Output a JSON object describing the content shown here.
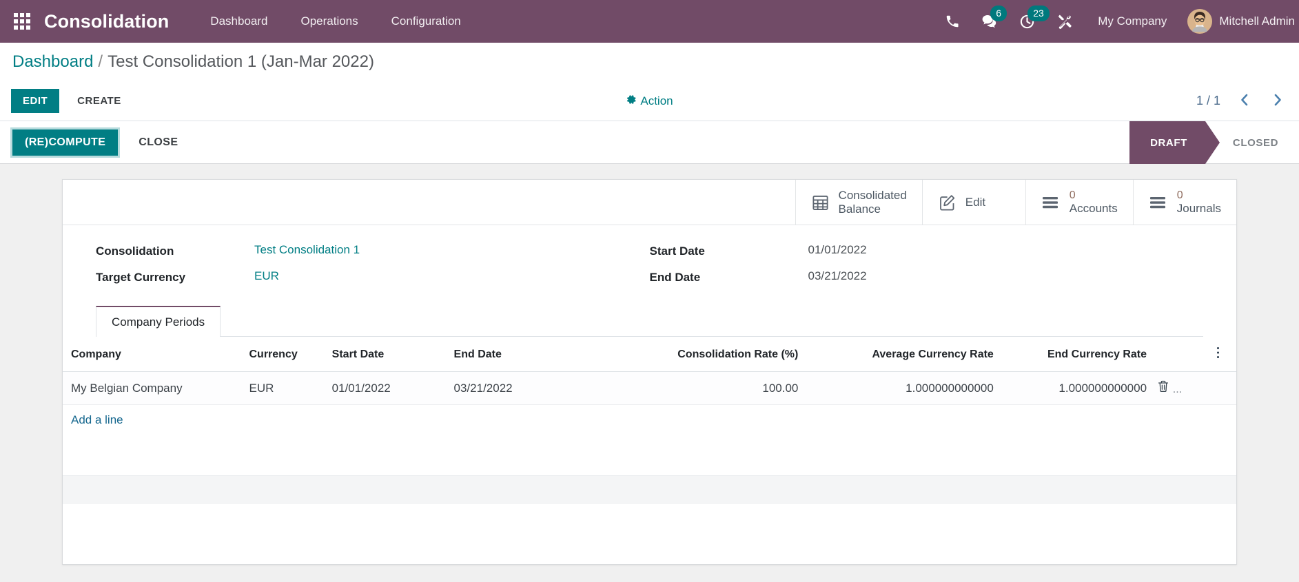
{
  "navbar": {
    "apps_icon": "apps-grid-icon",
    "brand": "Consolidation",
    "menu": [
      {
        "label": "Dashboard"
      },
      {
        "label": "Operations"
      },
      {
        "label": "Configuration"
      }
    ],
    "icons": [
      {
        "name": "phone-icon",
        "badge": null
      },
      {
        "name": "messages-icon",
        "badge": "6"
      },
      {
        "name": "activities-clock-icon",
        "badge": "23"
      },
      {
        "name": "debug-tools-icon",
        "badge": null
      }
    ],
    "company": "My Company",
    "user": "Mitchell Admin",
    "accent": "#714B67",
    "badge_color": "#00797d"
  },
  "breadcrumb": {
    "root": "Dashboard",
    "separator": "/",
    "current": "Test Consolidation 1 (Jan-Mar 2022)"
  },
  "control_panel": {
    "edit_label": "EDIT",
    "create_label": "CREATE",
    "action_label": "Action",
    "action_icon": "gear-icon",
    "pager_count": "1 / 1",
    "prev_icon": "chevron-left-icon",
    "next_icon": "chevron-right-icon"
  },
  "statusbar": {
    "recompute_label": "(RE)COMPUTE",
    "close_label": "CLOSE",
    "states": [
      {
        "label": "DRAFT",
        "active": true
      },
      {
        "label": "CLOSED",
        "active": false
      }
    ]
  },
  "stat_buttons": [
    {
      "icon": "table-grid-icon",
      "value": null,
      "line1": "Consolidated",
      "line2": "Balance"
    },
    {
      "icon": "pencil-edit-icon",
      "value": null,
      "line1": "Edit",
      "line2": ""
    },
    {
      "icon": "list-lines-icon",
      "value": "0",
      "line1": "Accounts",
      "line2": ""
    },
    {
      "icon": "list-lines-icon",
      "value": "0",
      "line1": "Journals",
      "line2": ""
    }
  ],
  "fields": {
    "consolidation_label": "Consolidation",
    "consolidation_value": "Test Consolidation 1",
    "target_currency_label": "Target Currency",
    "target_currency_value": "EUR",
    "start_date_label": "Start Date",
    "start_date_value": "01/01/2022",
    "end_date_label": "End Date",
    "end_date_value": "03/21/2022"
  },
  "notebook": {
    "tabs": [
      {
        "label": "Company Periods",
        "active": true
      }
    ]
  },
  "table": {
    "headers": [
      "Company",
      "Currency",
      "Start Date",
      "End Date",
      "Consolidation Rate (%)",
      "Average Currency Rate",
      "End Currency Rate"
    ],
    "optional_columns_icon": "vertical-dots-icon",
    "rows": [
      {
        "company": "My Belgian Company",
        "currency": "EUR",
        "start_date": "01/01/2022",
        "end_date": "03/21/2022",
        "consolidation_rate": "100.00",
        "average_currency_rate": "1.000000000000",
        "end_currency_rate": "1.000000000000",
        "delete_icon": "trash-icon",
        "overflow": "..."
      }
    ],
    "add_line_label": "Add a line"
  }
}
